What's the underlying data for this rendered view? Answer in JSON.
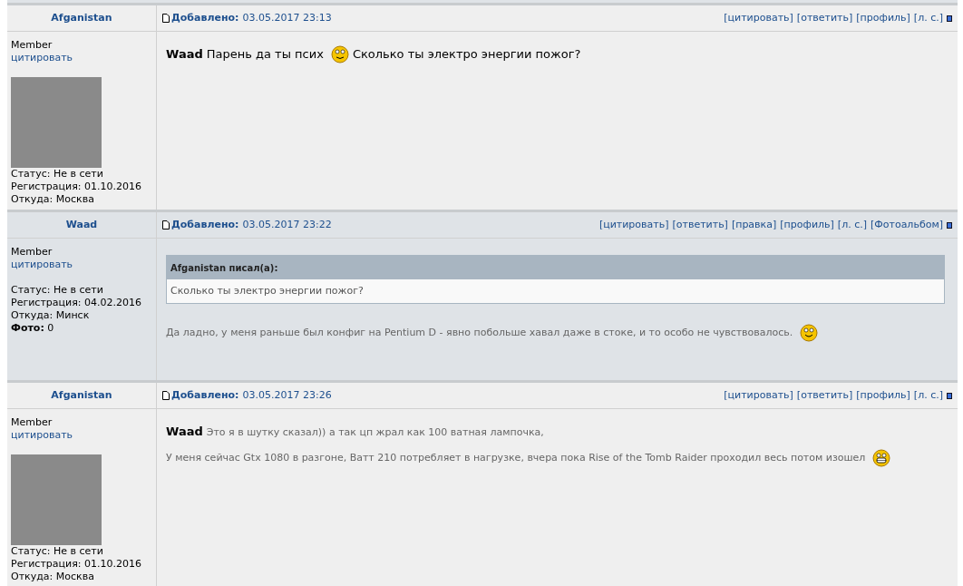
{
  "posts": [
    {
      "alternate": false,
      "author": "Afganistan",
      "added_label": "Добавлено:",
      "date": "03.05.2017 23:13",
      "actions": [
        "[цитировать]",
        "[ответить]",
        "[профиль]",
        "[л. с.]"
      ],
      "rank": "Member",
      "quote_link": "цитировать",
      "avatar": true,
      "fields": [
        "Статус: Не в сети",
        "Регистрация: 01.10.2016",
        "Откуда: Москва"
      ],
      "body": [
        {
          "kind": "message",
          "parts": [
            {
              "kind": "author",
              "text": "Waad"
            },
            {
              "kind": "text",
              "text": "Парень да ты псих"
            },
            {
              "kind": "wink"
            },
            {
              "kind": "text",
              "text": "Сколько ты электро энергии пожог?"
            }
          ]
        }
      ]
    },
    {
      "alternate": true,
      "author": "Waad",
      "added_label": "Добавлено:",
      "date": "03.05.2017 23:22",
      "actions": [
        "[цитировать]",
        "[ответить]",
        "[правка]",
        "[профиль]",
        "[л. с.]",
        "[Фотоальбом]"
      ],
      "rank": "Member",
      "quote_link": "цитировать",
      "avatar": false,
      "fields": [
        "Статус: Не в сети",
        "Регистрация: 04.02.2016",
        "Откуда: Минск",
        "**Фото:** 0"
      ],
      "body": [
        {
          "kind": "quote",
          "title": "Afganistan писал(а):",
          "text": "Сколько ты электро энергии пожог?"
        },
        {
          "kind": "paragraph",
          "parts": [
            {
              "kind": "text",
              "text": "Да ладно, у меня раньше был конфиг на Pentium D - явно побольше хавал даже в стоке, и то особо не чувствовалось."
            },
            {
              "kind": "smile"
            }
          ]
        }
      ]
    },
    {
      "alternate": false,
      "author": "Afganistan",
      "added_label": "Добавлено:",
      "date": "03.05.2017 23:26",
      "actions": [
        "[цитировать]",
        "[ответить]",
        "[профиль]",
        "[л. с.]"
      ],
      "rank": "Member",
      "quote_link": "цитировать",
      "avatar": true,
      "fields": [
        "Статус: Не в сети",
        "Регистрация: 01.10.2016",
        "Откуда: Москва"
      ],
      "body": [
        {
          "kind": "paragraph",
          "parts": [
            {
              "kind": "author",
              "text": "Waad"
            },
            {
              "kind": "text",
              "text": "Это я в шутку сказал)) а так цп жрал как 100 ватная лампочка,"
            }
          ]
        },
        {
          "kind": "paragraph",
          "parts": [
            {
              "kind": "text",
              "text": "У меня сейчас Gtx 1080 в разгоне, Ватт 210 потребляет в нагрузке, вчера пока Rise of the Tomb Raider проходил весь потом изошел"
            },
            {
              "kind": "grin"
            }
          ]
        }
      ]
    }
  ]
}
